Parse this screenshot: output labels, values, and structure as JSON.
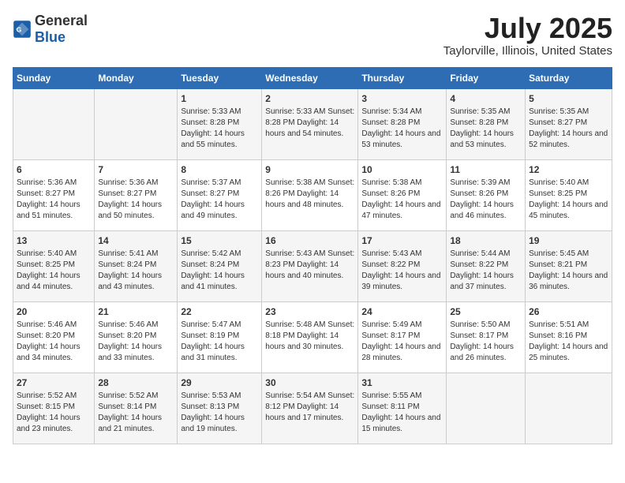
{
  "header": {
    "logo_general": "General",
    "logo_blue": "Blue",
    "month": "July 2025",
    "location": "Taylorville, Illinois, United States"
  },
  "days_of_week": [
    "Sunday",
    "Monday",
    "Tuesday",
    "Wednesday",
    "Thursday",
    "Friday",
    "Saturday"
  ],
  "weeks": [
    [
      {
        "day": "",
        "content": ""
      },
      {
        "day": "",
        "content": ""
      },
      {
        "day": "1",
        "content": "Sunrise: 5:33 AM\nSunset: 8:28 PM\nDaylight: 14 hours and 55 minutes."
      },
      {
        "day": "2",
        "content": "Sunrise: 5:33 AM\nSunset: 8:28 PM\nDaylight: 14 hours and 54 minutes."
      },
      {
        "day": "3",
        "content": "Sunrise: 5:34 AM\nSunset: 8:28 PM\nDaylight: 14 hours and 53 minutes."
      },
      {
        "day": "4",
        "content": "Sunrise: 5:35 AM\nSunset: 8:28 PM\nDaylight: 14 hours and 53 minutes."
      },
      {
        "day": "5",
        "content": "Sunrise: 5:35 AM\nSunset: 8:27 PM\nDaylight: 14 hours and 52 minutes."
      }
    ],
    [
      {
        "day": "6",
        "content": "Sunrise: 5:36 AM\nSunset: 8:27 PM\nDaylight: 14 hours and 51 minutes."
      },
      {
        "day": "7",
        "content": "Sunrise: 5:36 AM\nSunset: 8:27 PM\nDaylight: 14 hours and 50 minutes."
      },
      {
        "day": "8",
        "content": "Sunrise: 5:37 AM\nSunset: 8:27 PM\nDaylight: 14 hours and 49 minutes."
      },
      {
        "day": "9",
        "content": "Sunrise: 5:38 AM\nSunset: 8:26 PM\nDaylight: 14 hours and 48 minutes."
      },
      {
        "day": "10",
        "content": "Sunrise: 5:38 AM\nSunset: 8:26 PM\nDaylight: 14 hours and 47 minutes."
      },
      {
        "day": "11",
        "content": "Sunrise: 5:39 AM\nSunset: 8:26 PM\nDaylight: 14 hours and 46 minutes."
      },
      {
        "day": "12",
        "content": "Sunrise: 5:40 AM\nSunset: 8:25 PM\nDaylight: 14 hours and 45 minutes."
      }
    ],
    [
      {
        "day": "13",
        "content": "Sunrise: 5:40 AM\nSunset: 8:25 PM\nDaylight: 14 hours and 44 minutes."
      },
      {
        "day": "14",
        "content": "Sunrise: 5:41 AM\nSunset: 8:24 PM\nDaylight: 14 hours and 43 minutes."
      },
      {
        "day": "15",
        "content": "Sunrise: 5:42 AM\nSunset: 8:24 PM\nDaylight: 14 hours and 41 minutes."
      },
      {
        "day": "16",
        "content": "Sunrise: 5:43 AM\nSunset: 8:23 PM\nDaylight: 14 hours and 40 minutes."
      },
      {
        "day": "17",
        "content": "Sunrise: 5:43 AM\nSunset: 8:22 PM\nDaylight: 14 hours and 39 minutes."
      },
      {
        "day": "18",
        "content": "Sunrise: 5:44 AM\nSunset: 8:22 PM\nDaylight: 14 hours and 37 minutes."
      },
      {
        "day": "19",
        "content": "Sunrise: 5:45 AM\nSunset: 8:21 PM\nDaylight: 14 hours and 36 minutes."
      }
    ],
    [
      {
        "day": "20",
        "content": "Sunrise: 5:46 AM\nSunset: 8:20 PM\nDaylight: 14 hours and 34 minutes."
      },
      {
        "day": "21",
        "content": "Sunrise: 5:46 AM\nSunset: 8:20 PM\nDaylight: 14 hours and 33 minutes."
      },
      {
        "day": "22",
        "content": "Sunrise: 5:47 AM\nSunset: 8:19 PM\nDaylight: 14 hours and 31 minutes."
      },
      {
        "day": "23",
        "content": "Sunrise: 5:48 AM\nSunset: 8:18 PM\nDaylight: 14 hours and 30 minutes."
      },
      {
        "day": "24",
        "content": "Sunrise: 5:49 AM\nSunset: 8:17 PM\nDaylight: 14 hours and 28 minutes."
      },
      {
        "day": "25",
        "content": "Sunrise: 5:50 AM\nSunset: 8:17 PM\nDaylight: 14 hours and 26 minutes."
      },
      {
        "day": "26",
        "content": "Sunrise: 5:51 AM\nSunset: 8:16 PM\nDaylight: 14 hours and 25 minutes."
      }
    ],
    [
      {
        "day": "27",
        "content": "Sunrise: 5:52 AM\nSunset: 8:15 PM\nDaylight: 14 hours and 23 minutes."
      },
      {
        "day": "28",
        "content": "Sunrise: 5:52 AM\nSunset: 8:14 PM\nDaylight: 14 hours and 21 minutes."
      },
      {
        "day": "29",
        "content": "Sunrise: 5:53 AM\nSunset: 8:13 PM\nDaylight: 14 hours and 19 minutes."
      },
      {
        "day": "30",
        "content": "Sunrise: 5:54 AM\nSunset: 8:12 PM\nDaylight: 14 hours and 17 minutes."
      },
      {
        "day": "31",
        "content": "Sunrise: 5:55 AM\nSunset: 8:11 PM\nDaylight: 14 hours and 15 minutes."
      },
      {
        "day": "",
        "content": ""
      },
      {
        "day": "",
        "content": ""
      }
    ]
  ]
}
